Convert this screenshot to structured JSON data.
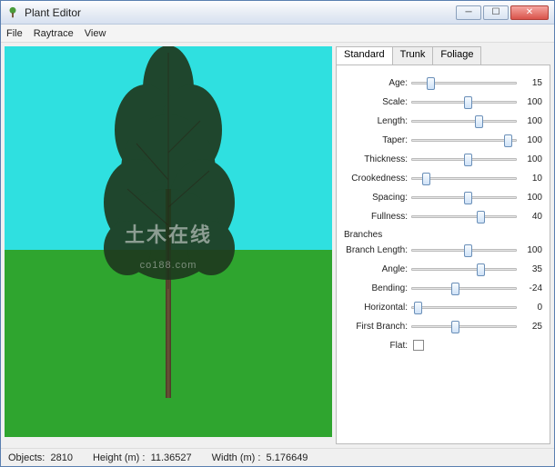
{
  "window": {
    "title": "Plant Editor"
  },
  "menu": {
    "file": "File",
    "raytrace": "Raytrace",
    "view": "View"
  },
  "tabs": {
    "standard": "Standard",
    "trunk": "Trunk",
    "foliage": "Foliage"
  },
  "params": {
    "age": {
      "label": "Age:",
      "value": "15",
      "pct": 15
    },
    "scale": {
      "label": "Scale:",
      "value": "100",
      "pct": 50
    },
    "length": {
      "label": "Length:",
      "value": "100",
      "pct": 60
    },
    "taper": {
      "label": "Taper:",
      "value": "100",
      "pct": 88
    },
    "thickness": {
      "label": "Thickness:",
      "value": "100",
      "pct": 50
    },
    "crookedness": {
      "label": "Crookedness:",
      "value": "10",
      "pct": 10
    },
    "spacing": {
      "label": "Spacing:",
      "value": "100",
      "pct": 50
    },
    "fullness": {
      "label": "Fullness:",
      "value": "40",
      "pct": 62
    }
  },
  "branches_section": "Branches",
  "branches": {
    "branch_length": {
      "label": "Branch Length:",
      "value": "100",
      "pct": 50
    },
    "angle": {
      "label": "Angle:",
      "value": "35",
      "pct": 62
    },
    "bending": {
      "label": "Bending:",
      "value": "-24",
      "pct": 38
    },
    "horizontal": {
      "label": "Horizontal:",
      "value": "0",
      "pct": 3
    },
    "first_branch": {
      "label": "First Branch:",
      "value": "25",
      "pct": 38
    },
    "flat": {
      "label": "Flat:",
      "checked": false
    }
  },
  "status": {
    "objects_label": "Objects:",
    "objects": "2810",
    "height_label": "Height (m) :",
    "height": "11.36527",
    "width_label": "Width (m) :",
    "width": "5.176649"
  },
  "watermark": {
    "main": "土木在线",
    "sub": "co188.com"
  }
}
